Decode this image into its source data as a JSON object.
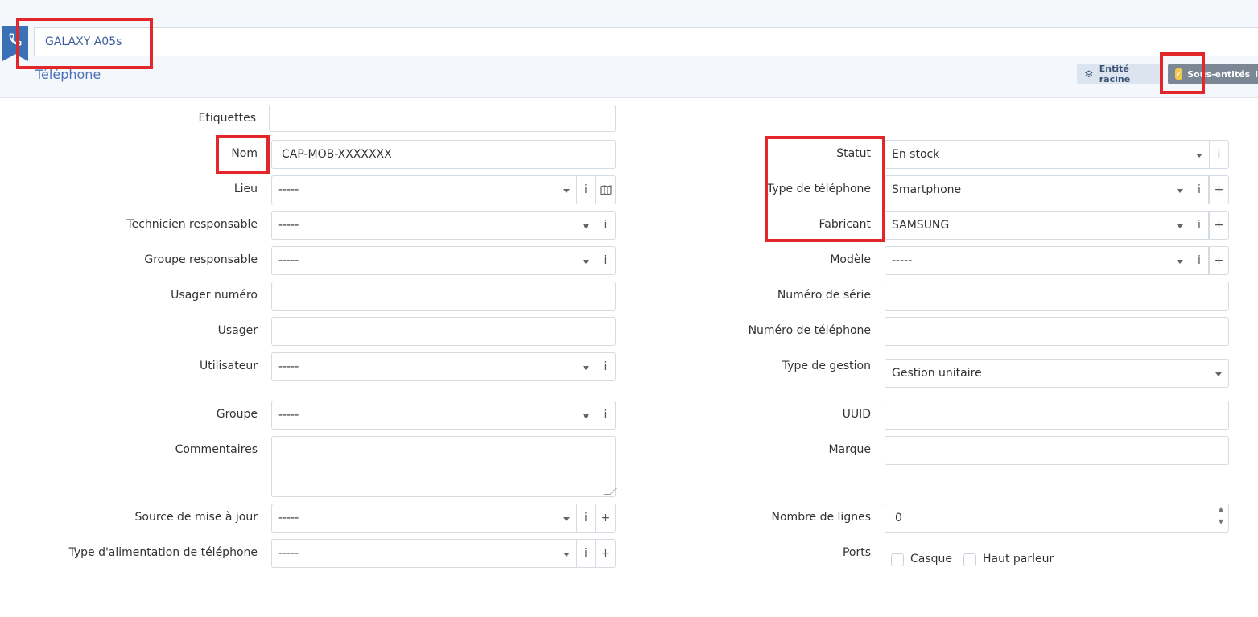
{
  "header": {
    "name_value": "GALAXY A05s",
    "item_type": "Téléphone",
    "root_entity_label": "Entité racine",
    "sub_entities_label": "Sous-entités",
    "info_glyph": "i"
  },
  "icons": [
    "phone-icon",
    "layers-icon",
    "check-icon",
    "info-icon",
    "map-icon",
    "plus-icon",
    "chevron-down-icon"
  ],
  "form": {
    "left": {
      "etiquettes": {
        "label": "Etiquettes",
        "value": ""
      },
      "nom": {
        "label": "Nom",
        "value": "CAP-MOB-XXXXXXX"
      },
      "lieu": {
        "label": "Lieu",
        "value": "-----"
      },
      "technicien": {
        "label": "Technicien responsable",
        "value": "-----"
      },
      "groupe_resp": {
        "label": "Groupe responsable",
        "value": "-----"
      },
      "usager_numero": {
        "label": "Usager numéro",
        "value": ""
      },
      "usager": {
        "label": "Usager",
        "value": ""
      },
      "utilisateur": {
        "label": "Utilisateur",
        "value": "-----"
      },
      "groupe": {
        "label": "Groupe",
        "value": "-----"
      },
      "commentaires": {
        "label": "Commentaires",
        "value": ""
      },
      "source_maj": {
        "label": "Source de mise à jour",
        "value": "-----"
      },
      "alimentation": {
        "label": "Type d'alimentation de téléphone",
        "value": "-----"
      }
    },
    "right": {
      "statut": {
        "label": "Statut",
        "value": "En stock"
      },
      "type_tel": {
        "label": "Type de téléphone",
        "value": "Smartphone"
      },
      "fabricant": {
        "label": "Fabricant",
        "value": "SAMSUNG"
      },
      "modele": {
        "label": "Modèle",
        "value": "-----"
      },
      "num_serie": {
        "label": "Numéro de série",
        "value": ""
      },
      "num_tel": {
        "label": "Numéro de téléphone",
        "value": ""
      },
      "type_gestion": {
        "label": "Type de gestion",
        "value": "Gestion unitaire"
      },
      "uuid": {
        "label": "UUID",
        "value": ""
      },
      "marque": {
        "label": "Marque",
        "value": ""
      },
      "nb_lignes": {
        "label": "Nombre de lignes",
        "value": "0"
      },
      "ports": {
        "label": "Ports",
        "casque": "Casque",
        "haut_parleur": "Haut parleur"
      }
    },
    "glyphs": {
      "info": "i",
      "plus": "+"
    }
  }
}
